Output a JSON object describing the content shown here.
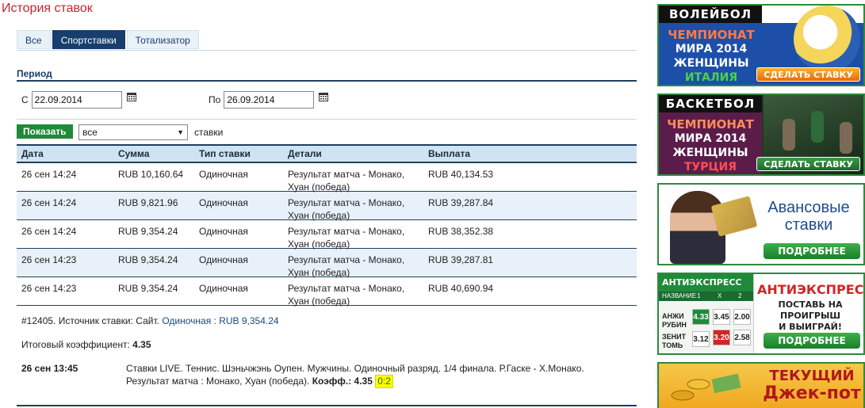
{
  "page_title": "История ставок",
  "tabs": [
    {
      "label": "Все",
      "active": false
    },
    {
      "label": "Спортставки",
      "active": true
    },
    {
      "label": "Тотализатор",
      "active": false
    }
  ],
  "period": {
    "label": "Период",
    "from_label": "С",
    "from_value": "22.09.2014",
    "to_label": "По",
    "to_value": "26.09.2014"
  },
  "filter": {
    "show_button": "Показать",
    "type_selected": "все",
    "suffix": "ставки"
  },
  "table": {
    "headers": [
      "Дата",
      "Сумма",
      "Тип ставки",
      "Детали",
      "Выплата"
    ],
    "rows": [
      {
        "date": "26 сен 14:24",
        "sum": "RUB 10,160.64",
        "type": "Одиночная",
        "details_1": "Результат матча - Монако,",
        "details_2": "Хуан (победа)",
        "payout": "RUB 40,134.53"
      },
      {
        "date": "26 сен 14:24",
        "sum": "RUB 9,821.96",
        "type": "Одиночная",
        "details_1": "Результат матча - Монако,",
        "details_2": "Хуан (победа)",
        "payout": "RUB 39,287.84"
      },
      {
        "date": "26 сен 14:24",
        "sum": "RUB 9,354.24",
        "type": "Одиночная",
        "details_1": "Результат матча - Монако,",
        "details_2": "Хуан (победа)",
        "payout": "RUB 38,352.38"
      },
      {
        "date": "26 сен 14:23",
        "sum": "RUB 9,354.24",
        "type": "Одиночная",
        "details_1": "Результат матча - Монако,",
        "details_2": "Хуан (победа)",
        "payout": "RUB 39,287.81"
      },
      {
        "date": "26 сен 14:23",
        "sum": "RUB 9,354.24",
        "type": "Одиночная",
        "details_1": "Результат матча - Монако,",
        "details_2": "Хуан (победа)",
        "payout": "RUB 40,690.94"
      }
    ]
  },
  "bet_detail": {
    "source_prefix": "#12405. Источник ставки: Сайт.",
    "source_link": "Одиночная : RUB 9,354.24",
    "total_coef_label": "Итоговый коэффициент:",
    "total_coef_value": "4.35",
    "event_time": "26 сен 13:45",
    "event_line1": "Ставки LIVE. Теннис. Шэньчжэнь Оупен. Мужчины. Одиночный разряд. 1/4 финала. Р.Гаске - Х.Монако.",
    "event_line2_prefix": "Результат матча : Монако, Хуан (победа).",
    "coef_label": "Коэфф.:",
    "coef_value": "4.35",
    "score": "0:2"
  },
  "banners": {
    "volleyball": {
      "head": "ВОЛЕЙБОЛ",
      "l1": "ЧЕМПИОНАТ",
      "l2": "МИРА 2014",
      "l3": "ЖЕНЩИНЫ",
      "l4": "ИТАЛИЯ",
      "button": "СДЕЛАТЬ СТАВКУ"
    },
    "basketball": {
      "head": "БАСКЕТБОЛ",
      "l1": "ЧЕМПИОНАТ",
      "l2": "МИРА 2014",
      "l3": "ЖЕНЩИНЫ",
      "l4": "ТУРЦИЯ",
      "button": "СДЕЛАТЬ СТАВКУ"
    },
    "advance": {
      "title1": "Авансовые",
      "title2": "ставки",
      "button": "ПОДРОБНЕЕ"
    },
    "antiexpress": {
      "table_head": "АНТИЭКСПРЕСС",
      "table_sub": "НАЗВАНИЕ",
      "col1": "1",
      "colx": "X",
      "col2": "2",
      "team1": "АНЖИ",
      "team1b": "РУБИН",
      "odds1": [
        "4.33",
        "3.45",
        "2.00"
      ],
      "team2": "ЗЕНИТ",
      "team2b": "ТОМЬ",
      "odds2": [
        "3.12",
        "3.20",
        "2.58"
      ],
      "title": "АНТИЭКСПРЕСС",
      "sub1": "ПОСТАВЬ НА ПРОИГРЫШ",
      "sub2": "И ВЫИГРАЙ!",
      "button": "ПОДРОБНЕЕ"
    },
    "jackpot": {
      "t1": "ТЕКУЩИЙ",
      "t2": "Джек-пот"
    }
  }
}
